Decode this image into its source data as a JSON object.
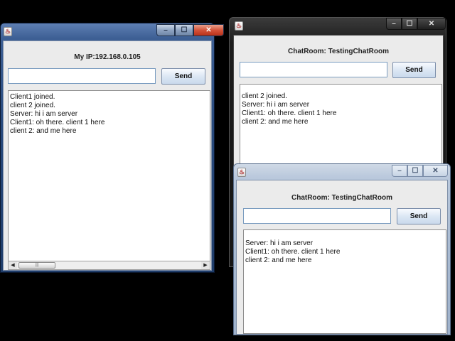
{
  "windows": {
    "server": {
      "header": "My IP:192.168.0.105",
      "input_value": "",
      "send_label": "Send",
      "messages": [
        "Client1 joined.",
        "client 2 joined.",
        "Server: hi i am server",
        "Client1: oh there. client 1 here",
        "client 2: and me here"
      ],
      "caption_min": "–",
      "caption_max": "☐",
      "caption_close": "✕",
      "icon": "java-icon"
    },
    "client2": {
      "header": "ChatRoom: TestingChatRoom",
      "input_value": "",
      "send_label": "Send",
      "messages": [
        "client 2 joined.",
        "Server: hi i am server",
        "Client1: oh there. client 1 here",
        "client 2: and me here"
      ],
      "caption_min": "–",
      "caption_max": "☐",
      "caption_close": "✕",
      "icon": "java-icon"
    },
    "client1": {
      "header": "ChatRoom: TestingChatRoom",
      "input_value": "",
      "send_label": "Send",
      "messages": [
        "Server: hi i am server",
        "Client1: oh there. client 1 here",
        "client 2: and me here"
      ],
      "caption_min": "–",
      "caption_max": "☐",
      "caption_close": "✕",
      "icon": "java-icon"
    }
  },
  "scrollbar": {
    "left_arrow": "◀",
    "right_arrow": "▶",
    "thumb_grip": "|||"
  },
  "colors": {
    "desktop": "#000000",
    "close_red": "#d4533a",
    "panel": "#ebebeb"
  }
}
